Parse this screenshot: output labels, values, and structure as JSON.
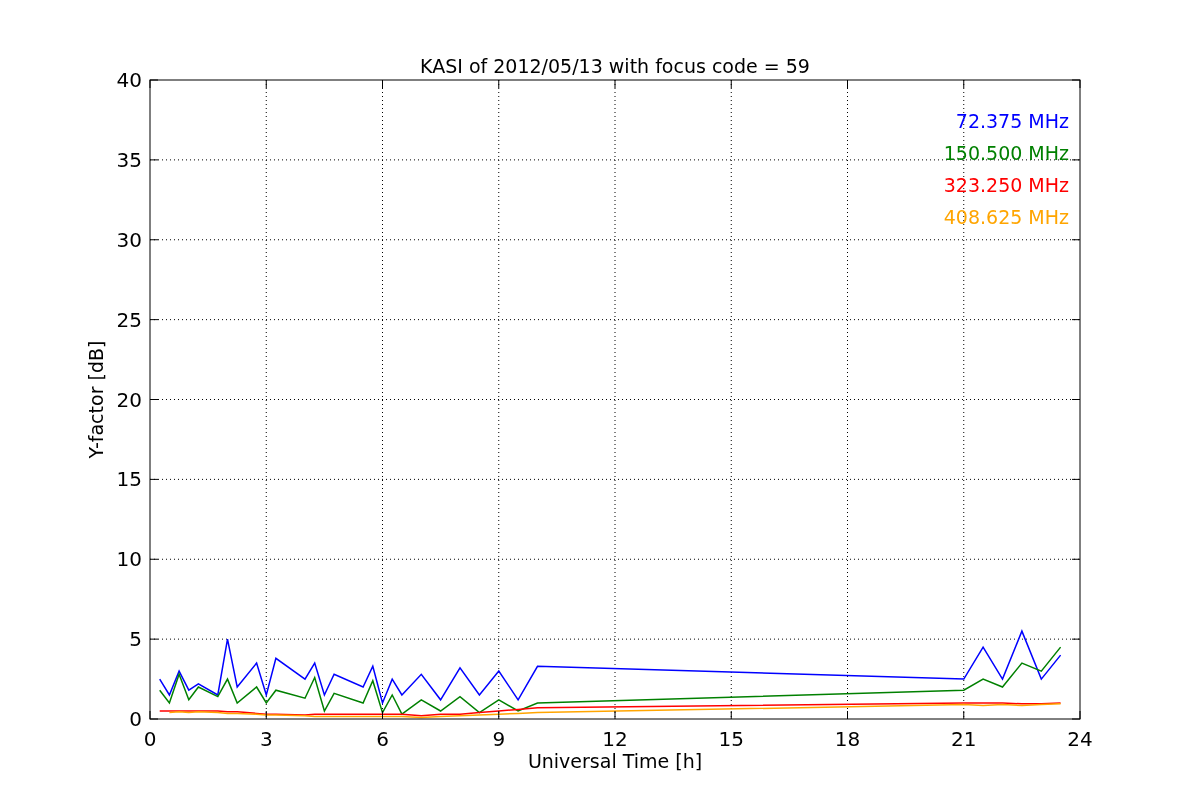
{
  "chart_data": {
    "type": "line",
    "grid": true,
    "title": "KASI of 2012/05/13 with focus code = 59",
    "xlabel": "Universal Time [h]",
    "ylabel": "Y-factor [dB]",
    "xlim": [
      0,
      24
    ],
    "ylim": [
      0,
      40
    ],
    "xticks": [
      0,
      3,
      6,
      9,
      12,
      15,
      18,
      21,
      24
    ],
    "yticks": [
      0,
      5,
      10,
      15,
      20,
      25,
      30,
      35,
      40
    ],
    "x": [
      0.25,
      0.5,
      0.75,
      1.0,
      1.25,
      1.75,
      2.0,
      2.25,
      2.75,
      3.0,
      3.25,
      4.0,
      4.25,
      4.5,
      4.75,
      5.5,
      5.75,
      6.0,
      6.25,
      6.5,
      7.0,
      7.5,
      8.0,
      8.5,
      9.0,
      9.5,
      10.0,
      21.0,
      21.5,
      22.0,
      22.5,
      23.0,
      23.5
    ],
    "series": [
      {
        "name": "72.375 MHz",
        "color": "#0000ff",
        "values": [
          2.5,
          1.5,
          3,
          1.8,
          2.2,
          1.5,
          5.0,
          2,
          3.5,
          1.5,
          3.8,
          2.5,
          3.5,
          1.5,
          2.8,
          2,
          3.3,
          1,
          2.5,
          1.5,
          2.8,
          1.2,
          3.2,
          1.5,
          3,
          1.2,
          3.3,
          2.5,
          4.5,
          2.5,
          5.5,
          2.5,
          4.0
        ]
      },
      {
        "name": "150.500 MHz",
        "color": "#008000",
        "values": [
          1.8,
          1.0,
          2.8,
          1.2,
          2.0,
          1.4,
          2.5,
          1.0,
          2.0,
          1.0,
          1.8,
          1.3,
          2.6,
          0.5,
          1.6,
          1.0,
          2.4,
          0.4,
          1.5,
          0.3,
          1.2,
          0.5,
          1.4,
          0.4,
          1.2,
          0.5,
          1.0,
          1.8,
          2.5,
          2.0,
          3.5,
          3.0,
          4.5
        ]
      },
      {
        "name": "323.250 MHz",
        "color": "#ff0000",
        "values": [
          0.5,
          0.5,
          0.5,
          0.5,
          0.5,
          0.5,
          0.45,
          0.45,
          0.35,
          0.3,
          0.3,
          0.25,
          0.3,
          0.3,
          0.3,
          0.3,
          0.3,
          0.3,
          0.3,
          0.3,
          0.2,
          0.3,
          0.3,
          0.4,
          0.5,
          0.6,
          0.7,
          1.0,
          1.0,
          1.0,
          0.95,
          0.95,
          1.0
        ]
      },
      {
        "name": "408.625 MHz",
        "color": "#ffa500",
        "values": [
          null,
          0.4,
          0.45,
          0.4,
          0.45,
          0.4,
          0.35,
          0.35,
          0.3,
          0.25,
          0.25,
          0.2,
          0.15,
          0.15,
          0.15,
          0.15,
          0.15,
          0.15,
          0.15,
          0.15,
          0.1,
          0.15,
          0.2,
          0.25,
          0.3,
          0.35,
          0.4,
          0.9,
          0.85,
          0.9,
          0.85,
          0.9,
          0.95
        ]
      }
    ]
  }
}
